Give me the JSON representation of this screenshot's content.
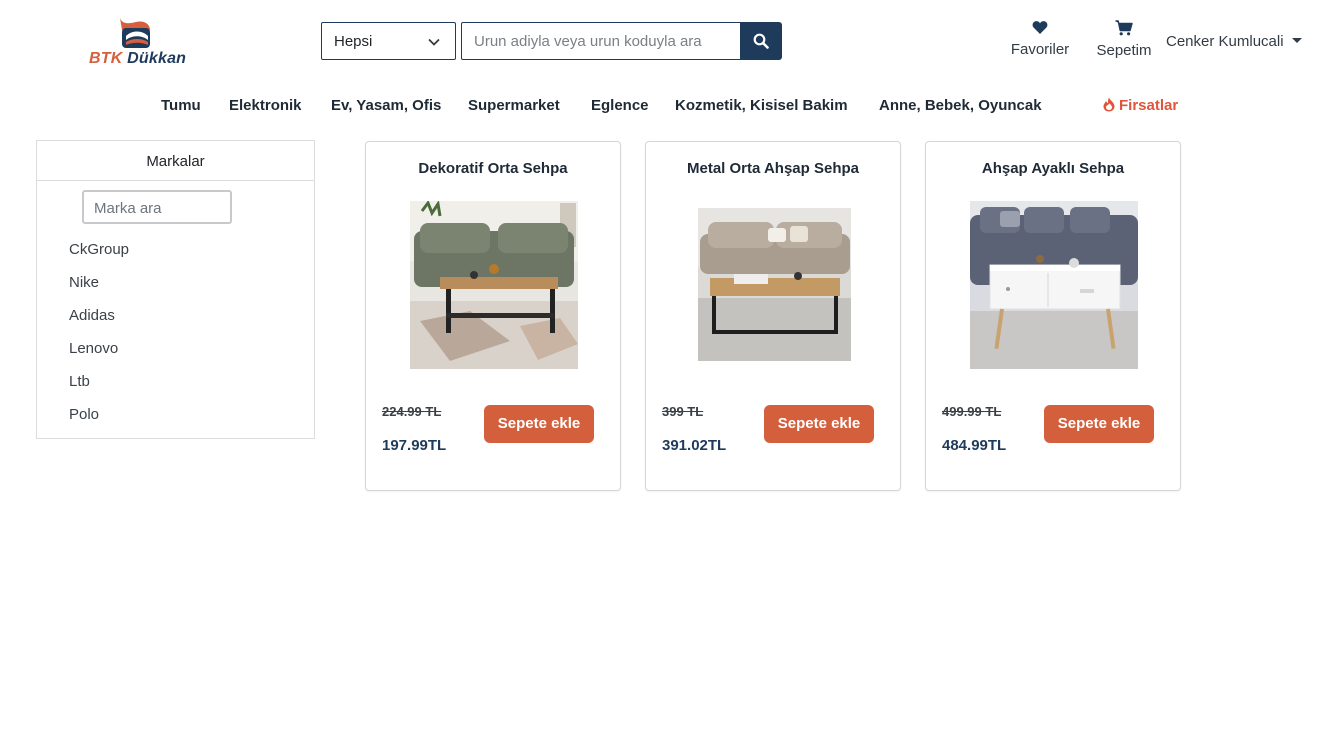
{
  "brand": {
    "name_part1": "BTK",
    "name_part2": "Dükkan",
    "colors": {
      "orange": "#d65f3e",
      "navy": "#1f3b5c"
    }
  },
  "search": {
    "category_value": "Hepsi",
    "placeholder": "Urun adiyla veya urun koduyla ara",
    "icon": "search-icon"
  },
  "header": {
    "favorites_label": "Favoriler",
    "cart_label": "Sepetim",
    "user_name": "Cenker Kumlucali"
  },
  "nav": {
    "items": [
      "Tumu",
      "Elektronik",
      "Ev, Yasam, Ofis",
      "Supermarket",
      "Eglence",
      "Kozmetik, Kisisel Bakim",
      "Anne, Bebek, Oyuncak"
    ],
    "deals_label": "Firsatlar",
    "deals_color": "#e0553b"
  },
  "sidebar": {
    "title": "Markalar",
    "search_placeholder": "Marka ara",
    "brands": [
      "CkGroup",
      "Nike",
      "Adidas",
      "Lenovo",
      "Ltb",
      "Polo"
    ]
  },
  "products": [
    {
      "title": "Dekoratif Orta Sehpa",
      "old_price": "224.99 TL",
      "new_price": "197.99TL",
      "button": "Sepete ekle"
    },
    {
      "title": "Metal Orta Ahşap Sehpa",
      "old_price": "399 TL",
      "new_price": "391.02TL",
      "button": "Sepete ekle"
    },
    {
      "title": "Ahşap Ayaklı Sehpa",
      "old_price": "499.99 TL",
      "new_price": "484.99TL",
      "button": "Sepete ekle"
    }
  ]
}
